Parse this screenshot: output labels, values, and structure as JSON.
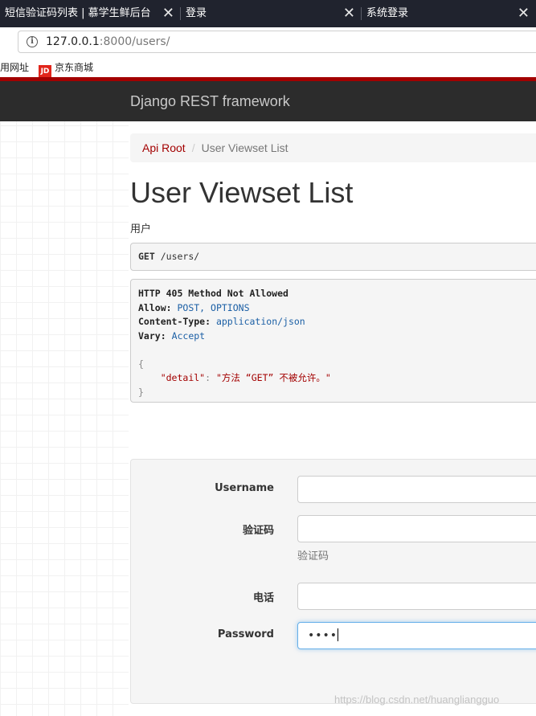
{
  "browser": {
    "tabs": [
      {
        "label": "短信验证码列表 | 慕学生鲜后台"
      },
      {
        "label": "登录"
      },
      {
        "label": "系统登录"
      }
    ],
    "close_glyph": "✕",
    "url_host": "127.0.0.1",
    "url_rest": ":8000/users/",
    "bookmarks": [
      {
        "label": "用网址"
      },
      {
        "label": "京东商城",
        "icon_text": "JD"
      }
    ]
  },
  "navbar": {
    "brand": "Django REST framework"
  },
  "breadcrumb": {
    "root": "Api Root",
    "separator": "/",
    "current": "User Viewset List"
  },
  "page": {
    "title": "User Viewset List",
    "description": "用户"
  },
  "request": {
    "method": "GET",
    "path": "/users/"
  },
  "response": {
    "status_line": "HTTP 405 Method Not Allowed",
    "allow_key": "Allow:",
    "allow_value": "POST, OPTIONS",
    "content_type_key": "Content-Type:",
    "content_type_value": "application/json",
    "vary_key": "Vary:",
    "vary_value": "Accept",
    "open_brace": "{",
    "json_key": "\"detail\"",
    "json_colon": ": ",
    "json_value": "\"方法 “GET” 不被允许。\"",
    "close_brace": "}"
  },
  "form": {
    "username_label": "Username",
    "code_label": "验证码",
    "code_help": "验证码",
    "mobile_label": "电话",
    "password_label": "Password",
    "password_value": "••••"
  },
  "watermark": "https://blog.csdn.net/huangliangguo",
  "colors": {
    "accent": "#a30000",
    "navbar": "#2c2c2c",
    "tabbar": "#20232e",
    "focus": "#66afe9"
  }
}
